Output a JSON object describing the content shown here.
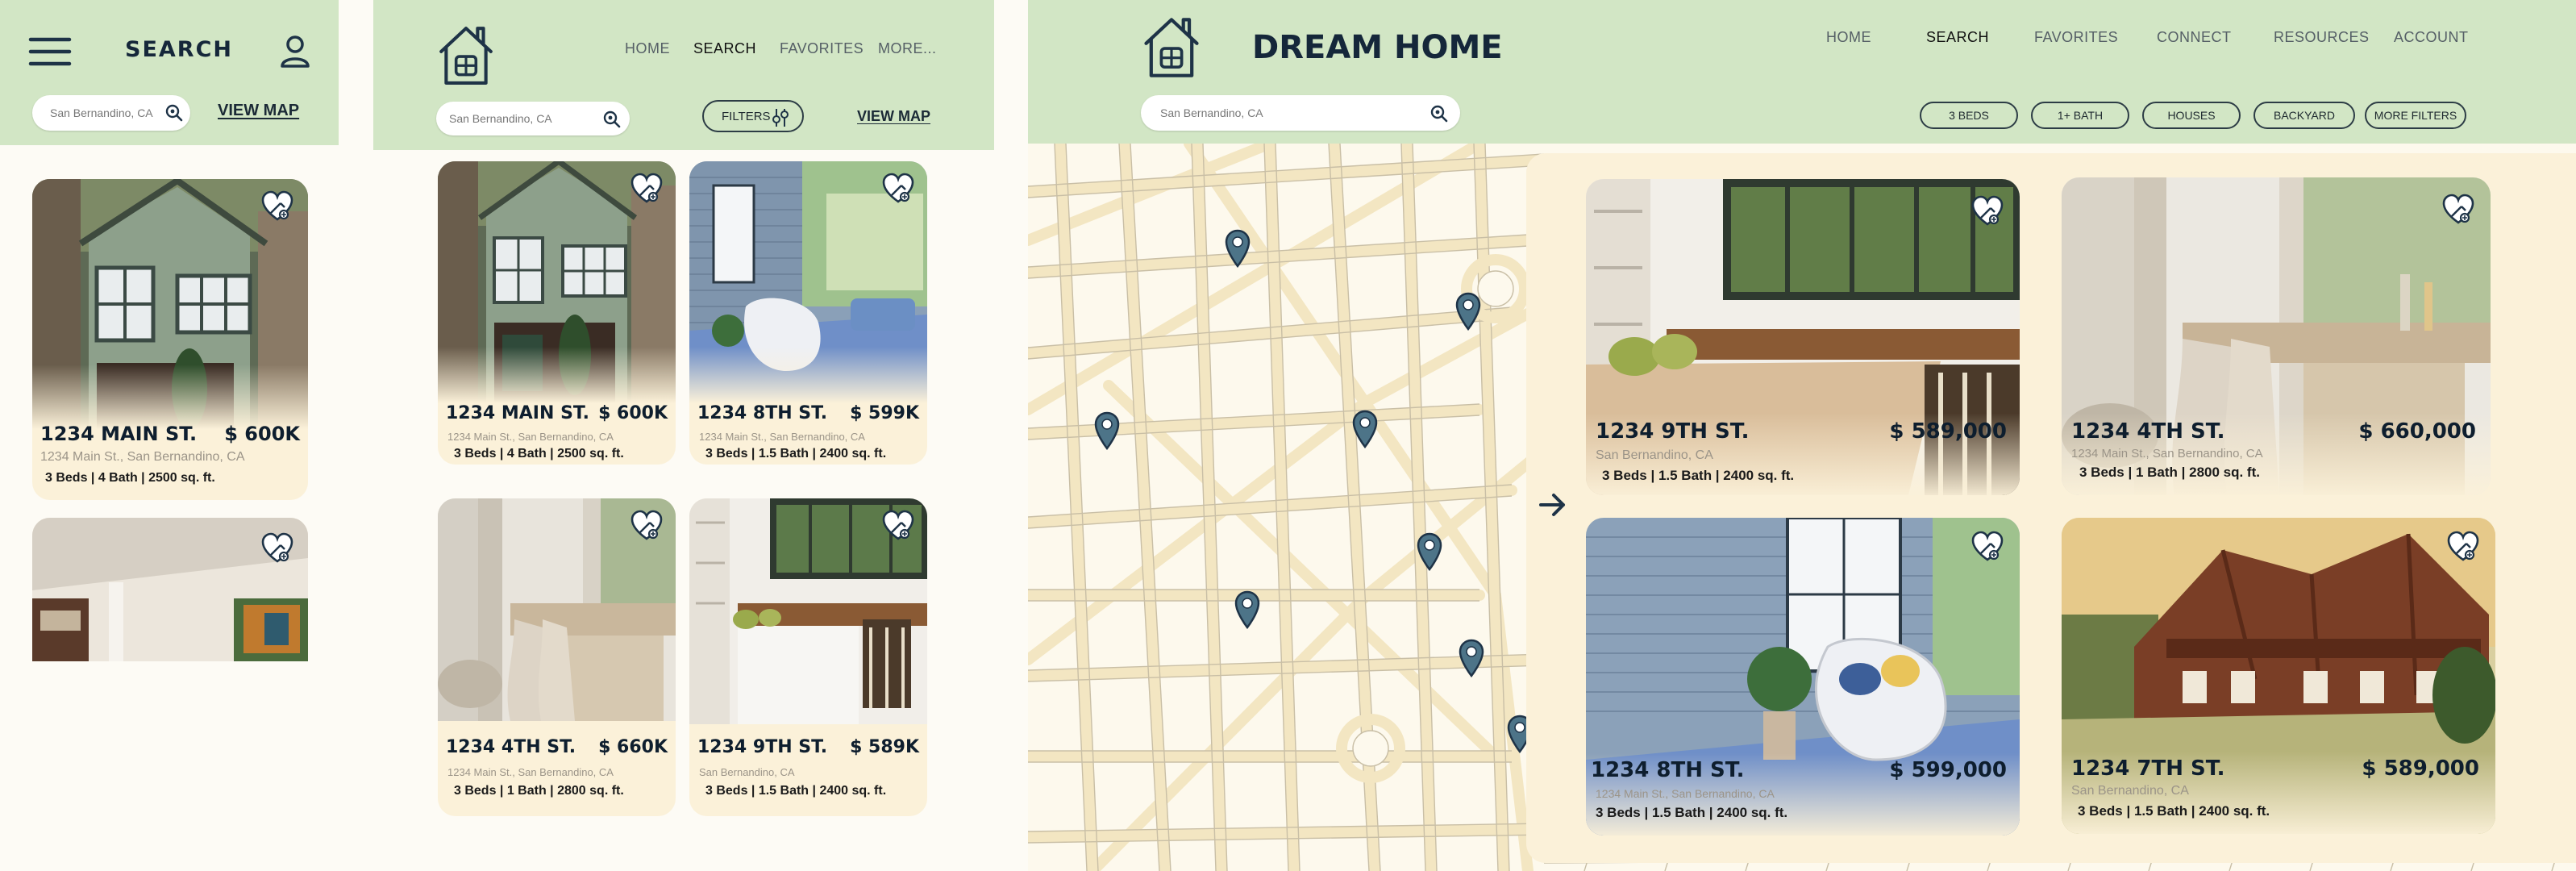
{
  "mobile": {
    "title": "SEARCH",
    "search_value": "San Bernandino, CA",
    "view_map": "VIEW MAP",
    "cards": [
      {
        "title": "1234 MAIN ST.",
        "price": "$ 600K",
        "address": "1234 Main St., San Bernandino, CA",
        "specs": "3 Beds | 4 Bath | 2500 sq. ft."
      }
    ]
  },
  "tablet": {
    "nav": [
      "HOME",
      "SEARCH",
      "FAVORITES",
      "MORE..."
    ],
    "search_value": "San Bernandino, CA",
    "filters": "FILTERS",
    "view_map": "VIEW MAP",
    "cards": [
      {
        "title": "1234 MAIN ST.",
        "price": "$ 600K",
        "address": "1234 Main St., San Bernandino, CA",
        "specs": "3 Beds | 4 Bath | 2500 sq. ft."
      },
      {
        "title": "1234 8TH  ST.",
        "price": "$ 599K",
        "address": "1234 Main St., San Bernandino, CA",
        "specs": "3 Beds | 1.5 Bath | 2400 sq. ft."
      },
      {
        "title": "1234 4TH  ST.",
        "price": "$ 660K",
        "address": "1234 Main St., San Bernandino, CA",
        "specs": "3 Beds | 1 Bath | 2800 sq. ft."
      },
      {
        "title": "1234 9TH  ST.",
        "price": "$ 589K",
        "address": "San Bernandino, CA",
        "specs": "3 Beds | 1.5 Bath | 2400 sq. ft."
      }
    ]
  },
  "desktop": {
    "brand": "DREAM HOME",
    "nav": [
      "HOME",
      "SEARCH",
      "FAVORITES",
      "CONNECT",
      "RESOURCES",
      "ACCOUNT"
    ],
    "search_value": "San Bernandino, CA",
    "filters": [
      "3 BEDS",
      "1+ BATH",
      "HOUSES",
      "BACKYARD",
      "MORE FILTERS"
    ],
    "cards": [
      {
        "title": "1234 9TH  ST.",
        "price": "$ 589,000",
        "address": "San Bernandino, CA",
        "specs": "3 Beds | 1.5 Bath | 2400 sq. ft."
      },
      {
        "title": "1234 4TH  ST.",
        "price": "$ 660,000",
        "address": "1234 Main St., San Bernandino, CA",
        "specs": "3 Beds | 1 Bath | 2800 sq. ft."
      },
      {
        "title": "1234 8TH  ST.",
        "price": "$ 599,000",
        "address": "1234 Main St., San Bernandino, CA",
        "specs": "3 Beds | 1.5 Bath | 2400 sq. ft."
      },
      {
        "title": "1234 7TH  ST.",
        "price": "$ 589,000",
        "address": "San Bernandino, CA",
        "specs": "3 Beds | 1.5 Bath | 2400 sq. ft."
      }
    ]
  },
  "colors": {
    "header": "#d2e6c5",
    "card": "#fbf1d9",
    "pin": "#4d7488",
    "map_bg": "#fdf9ed",
    "map_road": "#f5e8c6"
  },
  "icons": [
    "menu-icon",
    "user-icon",
    "search-icon",
    "house-logo-icon",
    "heart-icon",
    "filter-icon",
    "map-pin-icon",
    "arrow-right-icon"
  ]
}
